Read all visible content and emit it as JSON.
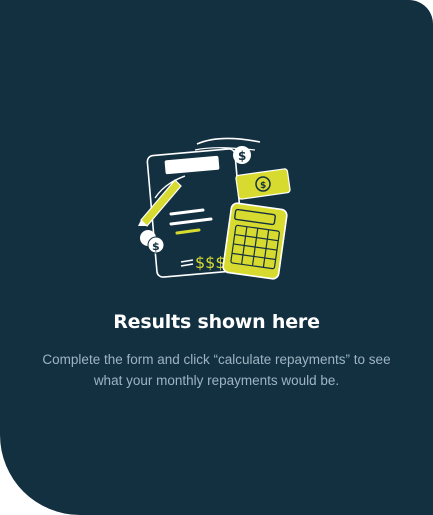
{
  "results": {
    "heading": "Results shown here",
    "description": "Complete the form and click “calculate repayments” to see what your monthly repayments would be."
  },
  "illustration": {
    "icon": "calculator-illustration",
    "dollar_sign": "$",
    "triple_dollar": "$$$"
  },
  "colors": {
    "panel_bg": "#133041",
    "accent": "#D8DB2F",
    "text_primary": "#FFFFFF",
    "text_secondary": "#9EB4C2"
  }
}
